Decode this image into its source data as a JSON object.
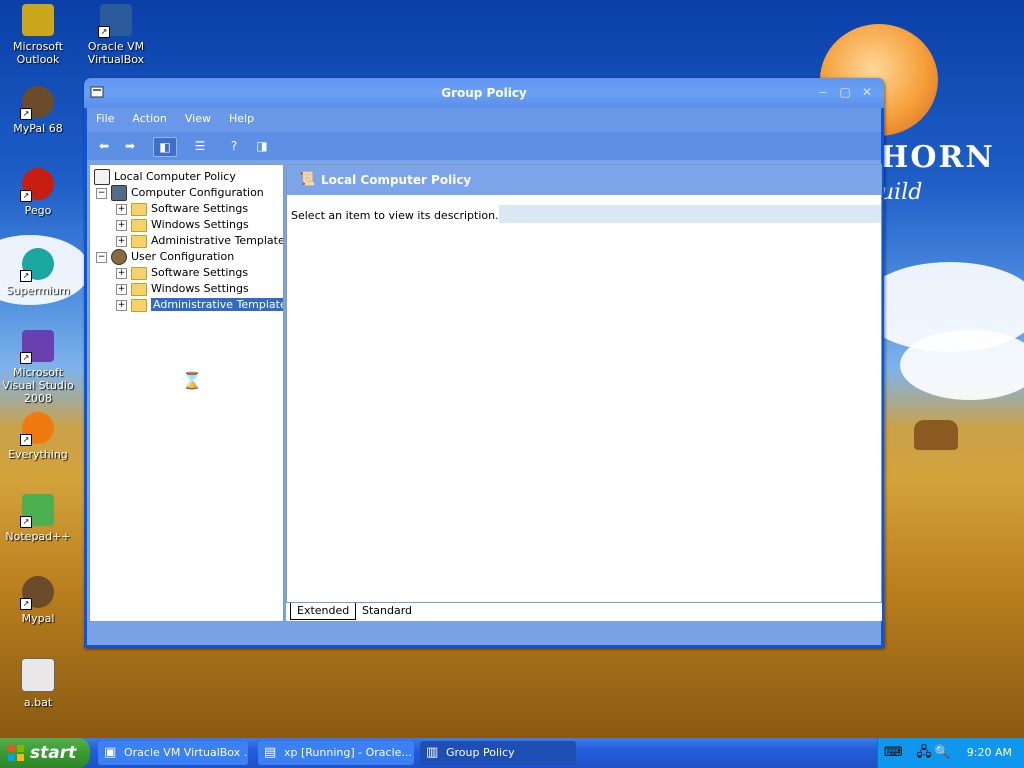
{
  "desktop": {
    "brand": {
      "text_line1": "HORN",
      "text_line2": "uild"
    },
    "icons": [
      {
        "label": "Microsoft Outlook",
        "color": "#c9a61a"
      },
      {
        "label": "Oracle VM VirtualBox",
        "color": "#2b5b9a"
      },
      {
        "label": "MyPal 68",
        "color": "#6b4b2a"
      },
      {
        "label": "Pego",
        "color": "#c81e10"
      },
      {
        "label": "Supermium",
        "color": "#1aa7a0"
      },
      {
        "label": "Microsoft Visual Studio 2008",
        "color": "#6a3fb0"
      },
      {
        "label": "Everything",
        "color": "#f07a10"
      },
      {
        "label": "Notepad++",
        "color": "#4caf50"
      },
      {
        "label": "Mypal",
        "color": "#6b4b2a"
      },
      {
        "label": "a.bat",
        "color": "#e8e8e8"
      }
    ]
  },
  "window": {
    "title": "Group Policy",
    "menu": [
      "File",
      "Action",
      "View",
      "Help"
    ],
    "tree": {
      "root": "Local Computer Policy",
      "computer_config": "Computer Configuration",
      "cc_software": "Software Settings",
      "cc_windows": "Windows Settings",
      "cc_admin": "Administrative Templates",
      "user_config": "User Configuration",
      "uc_software": "Software Settings",
      "uc_windows": "Windows Settings",
      "uc_admin": "Administrative Templates"
    },
    "right_pane": {
      "header": "Local Computer Policy",
      "description": "Select an item to view its description."
    },
    "tabs": {
      "extended": "Extended",
      "standard": "Standard"
    }
  },
  "taskbar": {
    "start_label": "start",
    "items": [
      {
        "label": "Oracle VM VirtualBox ..."
      },
      {
        "label": "xp [Running] - Oracle..."
      },
      {
        "label": "Group Policy"
      }
    ],
    "clock": "9:20 AM"
  }
}
